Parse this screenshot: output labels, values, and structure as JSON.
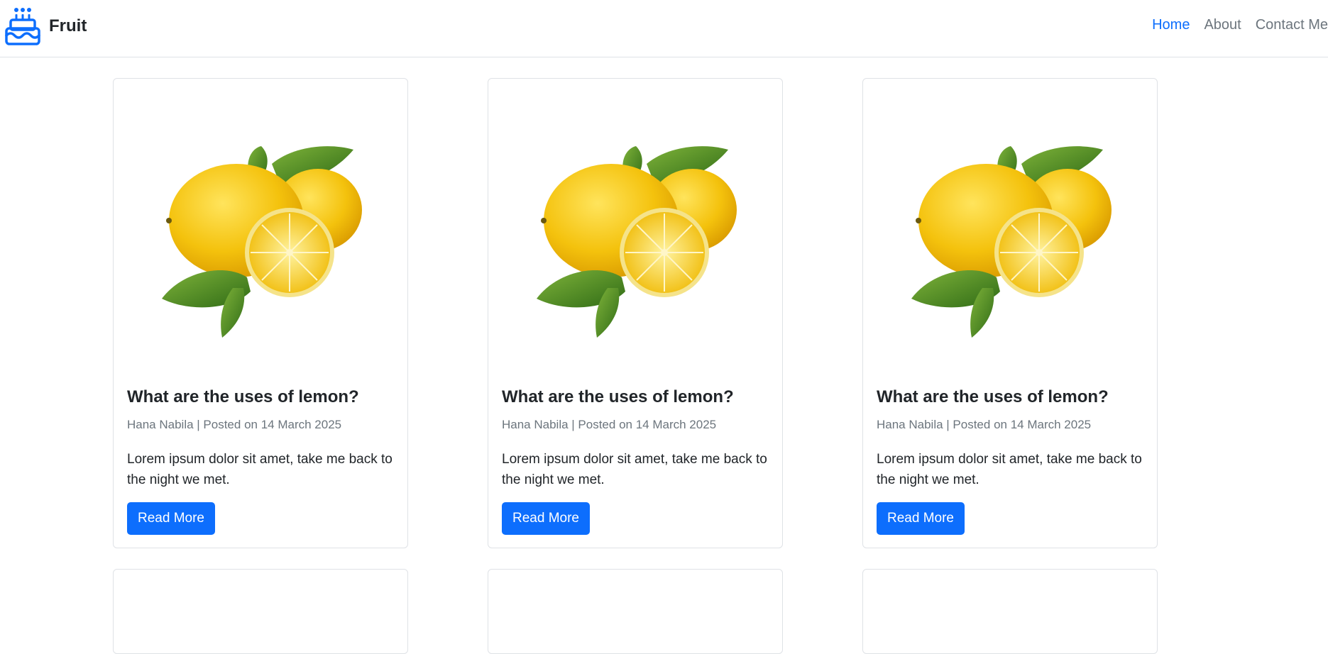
{
  "brand": {
    "name": "Fruit",
    "icon": "cake-icon",
    "color": "#0d6efd"
  },
  "nav": [
    {
      "label": "Home",
      "active": true
    },
    {
      "label": "About",
      "active": false
    },
    {
      "label": "Contact Me",
      "active": false
    }
  ],
  "posts": [
    {
      "image": "lemon-image",
      "title": "What are the uses of lemon?",
      "meta": "Hana Nabila | Posted on 14 March 2025",
      "excerpt": "Lorem ipsum dolor sit amet, take me back to the night we met.",
      "button": "Read More"
    },
    {
      "image": "lemon-image",
      "title": "What are the uses of lemon?",
      "meta": "Hana Nabila | Posted on 14 March 2025",
      "excerpt": "Lorem ipsum dolor sit amet, take me back to the night we met.",
      "button": "Read More"
    },
    {
      "image": "lemon-image",
      "title": "What are the uses of lemon?",
      "meta": "Hana Nabila | Posted on 14 March 2025",
      "excerpt": "Lorem ipsum dolor sit amet, take me back to the night we met.",
      "button": "Read More"
    }
  ],
  "colors": {
    "accent": "#0d6efd",
    "muted": "#6c757d",
    "text": "#212529"
  }
}
